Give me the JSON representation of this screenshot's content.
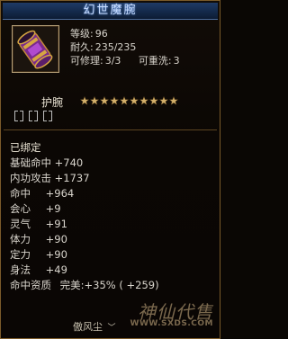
{
  "title": "幻世魔腕",
  "item": {
    "icon": "bracer-icon",
    "level_label": "等级:",
    "level": "96",
    "durability_label": "耐久:",
    "durability": "235/235",
    "repairable_label": "可修理:",
    "repairable": "3/3",
    "rewash_label": "可重洗:",
    "rewash": "3",
    "type": "护腕",
    "stars": 10
  },
  "bound_text": "已绑定",
  "attributes": [
    {
      "name": "基础命中",
      "value": "+740"
    },
    {
      "name": "内功攻击",
      "value": "+1737"
    },
    {
      "name": "命中",
      "value": "+964"
    },
    {
      "name": "会心",
      "value": "+9"
    },
    {
      "name": "灵气",
      "value": "+91"
    },
    {
      "name": "体力",
      "value": "+90"
    },
    {
      "name": "定力",
      "value": "+90"
    },
    {
      "name": "身法",
      "value": "+49"
    }
  ],
  "aptitude": {
    "name": "命中资质",
    "quality": "完美:",
    "percent": "+35%",
    "bonus": "( +259)"
  },
  "footer": "傲风尘",
  "watermark": {
    "brand": "神仙代售",
    "url": "WWW.SXDS.COM"
  },
  "colors": {
    "title_bg": "#1a3460",
    "border": "#7a5a2a",
    "bound": "#e8e2d2",
    "star": "#d4b06a"
  }
}
